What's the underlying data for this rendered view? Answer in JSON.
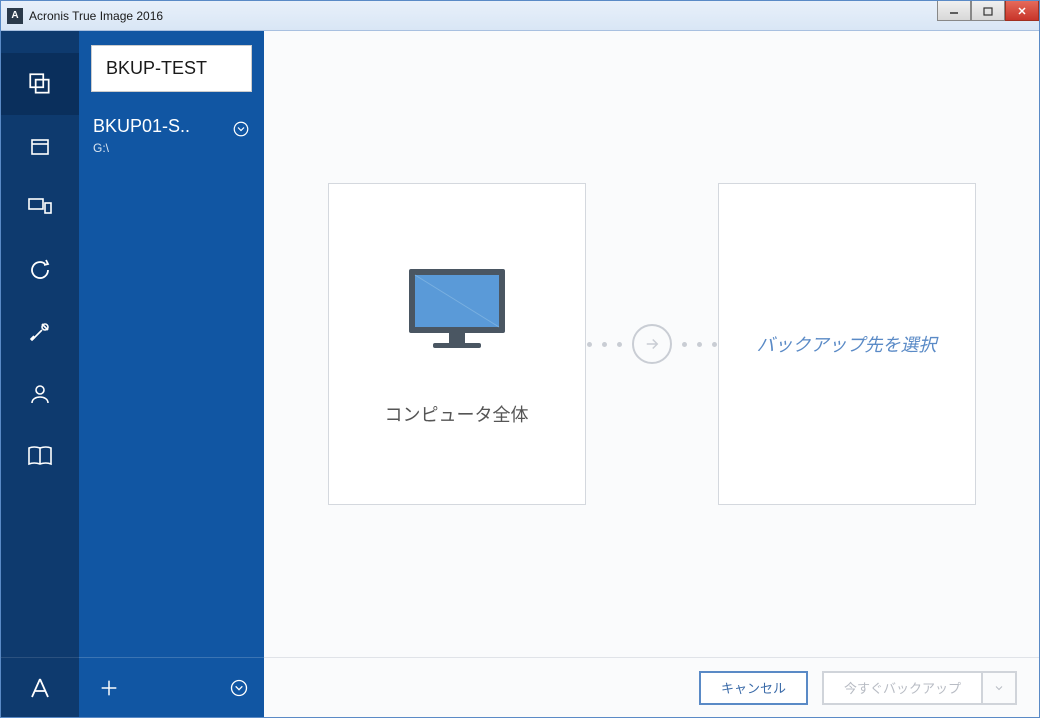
{
  "window": {
    "title": "Acronis True Image 2016",
    "icon_letter": "A"
  },
  "backup_list": {
    "selected": {
      "title": "BKUP-TEST"
    },
    "items": [
      {
        "title": "BKUP01-S..",
        "sub": "G:\\"
      }
    ]
  },
  "main": {
    "source_label": "コンピュータ全体",
    "destination_label": "バックアップ先を選択"
  },
  "footer": {
    "cancel": "キャンセル",
    "backup_now": "今すぐバックアップ"
  }
}
